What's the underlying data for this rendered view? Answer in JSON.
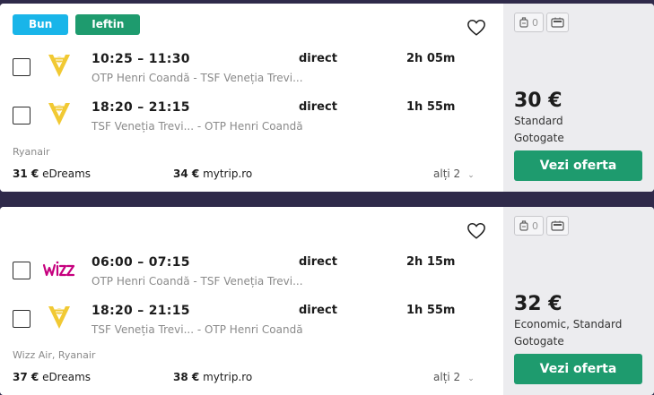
{
  "results": [
    {
      "badges": [
        "Bun",
        "Ieftin"
      ],
      "legs": [
        {
          "times": "10:25 – 11:30",
          "airports": "OTP Henri Coandă - TSF Veneția Trevi...",
          "stops": "direct",
          "duration": "2h 05m",
          "logo": "ryanair"
        },
        {
          "times": "18:20 – 21:15",
          "airports": "TSF Veneția Trevi... - OTP Henri Coandă",
          "stops": "direct",
          "duration": "1h 55m",
          "logo": "ryanair"
        }
      ],
      "airlines": "Ryanair",
      "offers": [
        {
          "price": "31 €",
          "site": "eDreams"
        },
        {
          "price": "34 €",
          "site": "mytrip.ro"
        }
      ],
      "others_label": "alți 2",
      "cabin_bag_count": "0",
      "price": "30 €",
      "fare_type": "Standard",
      "provider": "Gotogate",
      "cta": "Vezi oferta"
    },
    {
      "badges": [],
      "legs": [
        {
          "times": "06:00 – 07:15",
          "airports": "OTP Henri Coandă - TSF Veneția Trevi...",
          "stops": "direct",
          "duration": "2h 15m",
          "logo": "wizzair"
        },
        {
          "times": "18:20 – 21:15",
          "airports": "TSF Veneția Trevi... - OTP Henri Coandă",
          "stops": "direct",
          "duration": "1h 55m",
          "logo": "ryanair"
        }
      ],
      "airlines": "Wizz Air, Ryanair",
      "offers": [
        {
          "price": "37 €",
          "site": "eDreams"
        },
        {
          "price": "38 €",
          "site": "mytrip.ro"
        }
      ],
      "others_label": "alți 2",
      "cabin_bag_count": "0",
      "price": "32 €",
      "fare_type": "Economic, Standard",
      "provider": "Gotogate",
      "cta": "Vezi oferta"
    }
  ],
  "colors": {
    "accent": "#1e9b6e",
    "badge_good": "#19b5e9",
    "ryanair_yellow": "#f1c933",
    "wizz_pink": "#c6007e"
  }
}
